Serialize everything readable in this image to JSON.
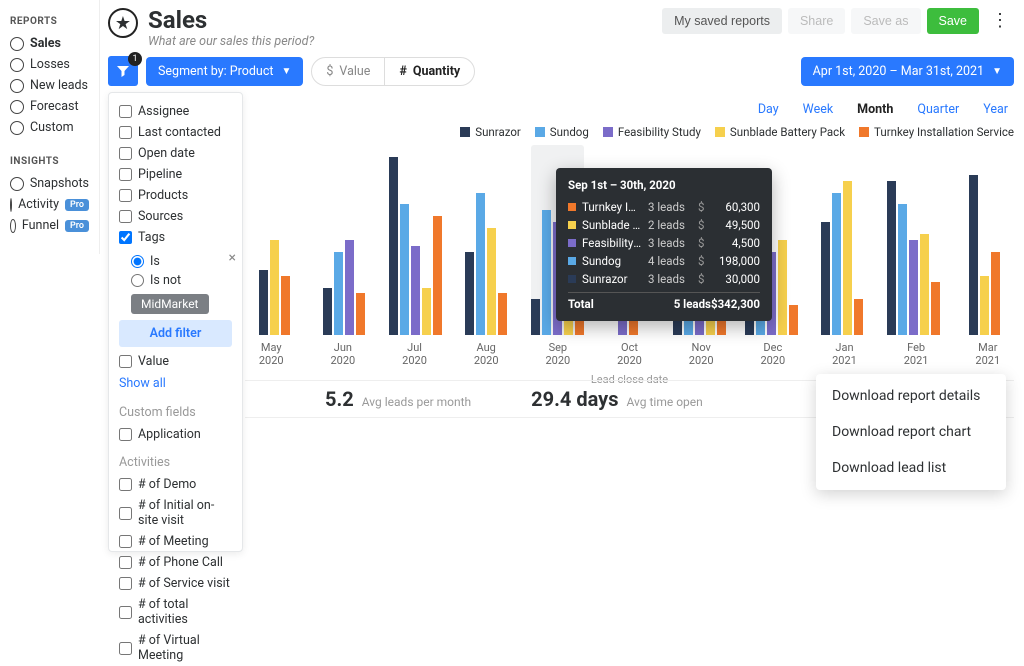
{
  "sidebar": {
    "reports_heading": "REPORTS",
    "insights_heading": "INSIGHTS",
    "reports": [
      {
        "label": "Sales",
        "active": true
      },
      {
        "label": "Losses"
      },
      {
        "label": "New leads"
      },
      {
        "label": "Forecast"
      },
      {
        "label": "Custom"
      }
    ],
    "insights": [
      {
        "label": "Snapshots"
      },
      {
        "label": "Activity",
        "badge": "Pro"
      },
      {
        "label": "Funnel",
        "badge": "Pro"
      }
    ]
  },
  "header": {
    "title": "Sales",
    "subtitle": "What are our sales this period?",
    "buttons": {
      "saved": "My saved reports",
      "share": "Share",
      "save_as": "Save as",
      "save": "Save"
    }
  },
  "toolbar": {
    "filter_count": "1",
    "segment_label": "Segment by: Product",
    "value_sym": "$",
    "value_label": "Value",
    "qty_sym": "#",
    "qty_label": "Quantity",
    "date_range": "Apr 1st, 2020 – Mar 31st, 2021"
  },
  "granularity": {
    "items": [
      "Day",
      "Week",
      "Month",
      "Quarter",
      "Year"
    ],
    "active": "Month"
  },
  "legend": [
    {
      "name": "Sunrazor",
      "color": "#2a3b57"
    },
    {
      "name": "Sundog",
      "color": "#5aa9e6"
    },
    {
      "name": "Feasibility Study",
      "color": "#7b6cc9"
    },
    {
      "name": "Sunblade Battery Pack",
      "color": "#f6d04d"
    },
    {
      "name": "Turnkey Installation Service",
      "color": "#f0782b"
    }
  ],
  "filter_panel": {
    "fields": [
      "Assignee",
      "Last contacted",
      "Open date",
      "Pipeline",
      "Products",
      "Sources",
      "Tags"
    ],
    "checked": "Tags",
    "radio_is": "Is",
    "radio_isnot": "Is not",
    "chip": "MidMarket",
    "add_filter": "Add filter",
    "value": "Value",
    "show_all": "Show all",
    "custom_fields_label": "Custom fields",
    "custom_fields": [
      "Application"
    ],
    "activities_label": "Activities",
    "activities": [
      "# of Demo",
      "# of Initial on-site visit",
      "# of Meeting",
      "# of Phone Call",
      "# of Service visit",
      "# of total activities",
      "# of Virtual Meeting"
    ]
  },
  "tooltip": {
    "title": "Sep 1st – 30th, 2020",
    "rows": [
      {
        "color": "#f0782b",
        "name": "Turnkey Installation Service",
        "leads": "3 leads",
        "value": "60,300"
      },
      {
        "color": "#f6d04d",
        "name": "Sunblade Battery Pack",
        "leads": "2 leads",
        "value": "49,500"
      },
      {
        "color": "#7b6cc9",
        "name": "Feasibility Study",
        "leads": "3 leads",
        "value": "4,500"
      },
      {
        "color": "#5aa9e6",
        "name": "Sundog",
        "leads": "4 leads",
        "value": "198,000"
      },
      {
        "color": "#2a3b57",
        "name": "Sunrazor",
        "leads": "3 leads",
        "value": "30,000"
      }
    ],
    "total_label": "Total",
    "total_leads": "5 leads",
    "total_value": "342,300",
    "currency": "$"
  },
  "summary": [
    {
      "value": "5.2",
      "label": "Avg leads per month"
    },
    {
      "value": "29.4 days",
      "label": "Avg time open"
    }
  ],
  "download_menu": [
    "Download report details",
    "Download report chart",
    "Download lead list"
  ],
  "axis": {
    "title": "Lead close date"
  },
  "chart_data": {
    "type": "bar",
    "xlabel": "Lead close date",
    "ylabel": "",
    "categories": [
      "May 2020",
      "Jun 2020",
      "Jul 2020",
      "Aug 2020",
      "Sep 2020",
      "Oct 2020",
      "Nov 2020",
      "Dec 2020",
      "Jan 2021",
      "Feb 2021",
      "Mar 2021"
    ],
    "series": [
      {
        "name": "Sunrazor",
        "color": "#2a3b57",
        "values": [
          55,
          40,
          150,
          70,
          30,
          0,
          105,
          130,
          95,
          130,
          135
        ]
      },
      {
        "name": "Sundog",
        "color": "#5aa9e6",
        "values": [
          0,
          70,
          110,
          120,
          105,
          0,
          85,
          100,
          120,
          110,
          0
        ]
      },
      {
        "name": "Feasibility Study",
        "color": "#7b6cc9",
        "values": [
          0,
          80,
          75,
          0,
          95,
          30,
          60,
          70,
          0,
          80,
          0
        ]
      },
      {
        "name": "Sunblade Battery Pack",
        "color": "#f6d04d",
        "values": [
          80,
          0,
          40,
          90,
          95,
          0,
          55,
          80,
          130,
          85,
          50
        ]
      },
      {
        "name": "Turnkey Installation Service",
        "color": "#f0782b",
        "values": [
          50,
          35,
          100,
          35,
          55,
          50,
          35,
          25,
          30,
          45,
          70
        ]
      }
    ],
    "highlighted_category": "Sep 2020",
    "ylim": [
      0,
      160
    ]
  }
}
